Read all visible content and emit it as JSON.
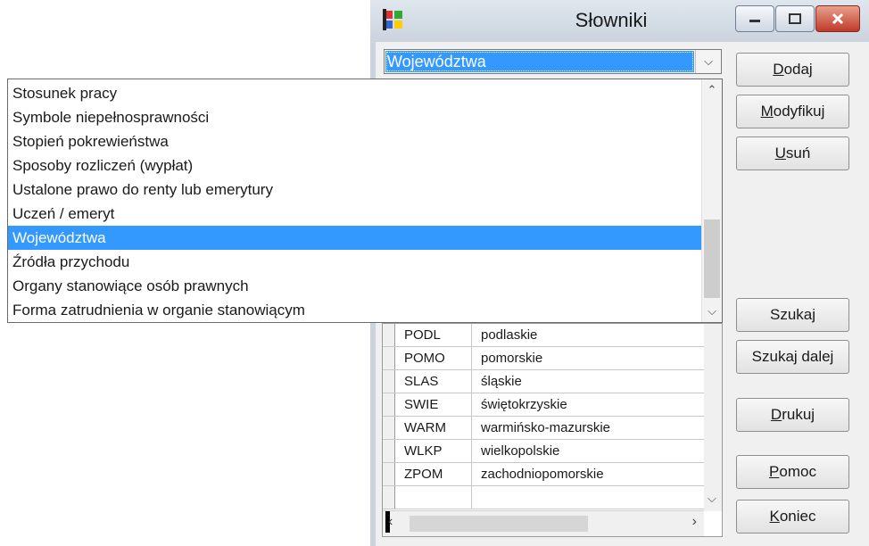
{
  "window": {
    "title": "Słowniki",
    "controls": [
      "minimize-icon",
      "maximize-icon",
      "close-icon"
    ]
  },
  "combo": {
    "value": "Województwa"
  },
  "dropdown": {
    "items": [
      "Stosunek pracy",
      "Symbole niepełnosprawności",
      "Stopień pokrewieństwa",
      "Sposoby rozliczeń (wypłat)",
      "Ustalone prawo do renty lub emerytury",
      "Uczeń / emeryt",
      "Województwa",
      "Źródła przychodu",
      "Organy stanowiące osób prawnych",
      "Forma zatrudnienia w organie stanowiącym"
    ],
    "selected": "Województwa"
  },
  "buttons": {
    "dodaj": {
      "hotkey": "D",
      "rest": "odaj"
    },
    "modyfikuj": {
      "hotkey": "M",
      "rest": "odyfikuj"
    },
    "usun": {
      "hotkey": "U",
      "rest": "suń"
    },
    "szukaj": {
      "label": "Szukaj"
    },
    "szukaj_dalej": {
      "label": "Szukaj dalej"
    },
    "drukuj": {
      "hotkey": "D",
      "rest": "rukuj"
    },
    "pomoc": {
      "hotkey": "P",
      "rest": "omoc"
    },
    "koniec": {
      "hotkey": "K",
      "rest": "oniec"
    }
  },
  "grid": {
    "rows": [
      {
        "code": "PODL",
        "name": "podlaskie"
      },
      {
        "code": "POMO",
        "name": "pomorskie"
      },
      {
        "code": "SLAS",
        "name": "śląskie"
      },
      {
        "code": "SWIE",
        "name": "świętokrzyskie"
      },
      {
        "code": "WARM",
        "name": "warmińsko-mazurskie"
      },
      {
        "code": "WLKP",
        "name": "wielkopolskie"
      },
      {
        "code": "ZPOM",
        "name": "zachodniopomorskie"
      },
      {
        "code": "",
        "name": ""
      }
    ]
  },
  "colors": {
    "selection": "#3399ff",
    "titlebar": "#cbd4de"
  }
}
